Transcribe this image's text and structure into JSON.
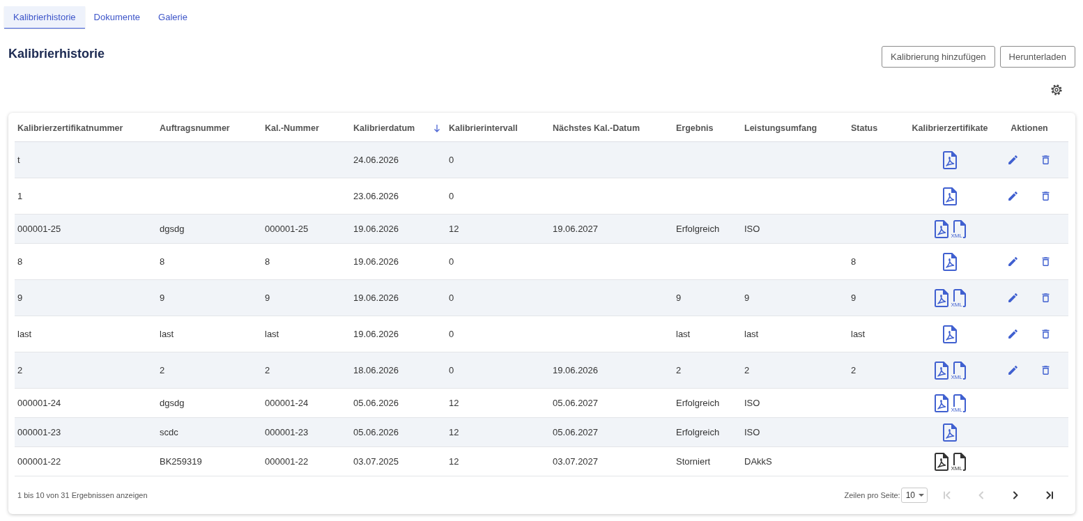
{
  "tabs": [
    {
      "label": "Kalibrierhistorie",
      "selected": true
    },
    {
      "label": "Dokumente",
      "selected": false
    },
    {
      "label": "Galerie",
      "selected": false
    }
  ],
  "page": {
    "title": "Kalibrierhistorie",
    "buttons": [
      "Kalibrierung hinzufügen",
      "Herunterladen"
    ]
  },
  "table": {
    "columns": [
      {
        "label": "Kalibrierzertifikatnummer",
        "sorted": false
      },
      {
        "label": "Auftragsnummer",
        "sorted": false
      },
      {
        "label": "Kal.-Nummer",
        "sorted": false
      },
      {
        "label": "Kalibrierdatum",
        "sorted": true
      },
      {
        "label": "Kalibrierintervall",
        "sorted": false
      },
      {
        "label": "Nächstes Kal.-Datum",
        "sorted": false
      },
      {
        "label": "Ergebnis",
        "sorted": false
      },
      {
        "label": "Leistungsumfang",
        "sorted": false
      },
      {
        "label": "Status",
        "sorted": false
      },
      {
        "label": "Kalibrierzertifikate",
        "sorted": false
      },
      {
        "label": "Aktionen",
        "sorted": false
      }
    ],
    "rows": [
      {
        "cells": [
          "t",
          null,
          null,
          "24.06.2026",
          "0",
          null,
          null,
          null,
          null
        ],
        "certificates": [
          {
            "kind": "pdf",
            "color": "#4060d0"
          }
        ],
        "actions": [
          {
            "kind": "edit"
          },
          {
            "kind": "delete"
          }
        ]
      },
      {
        "cells": [
          "1",
          null,
          null,
          "23.06.2026",
          "0",
          null,
          null,
          null,
          null
        ],
        "certificates": [
          {
            "kind": "pdf",
            "color": "#4060d0"
          }
        ],
        "actions": [
          {
            "kind": "edit"
          },
          {
            "kind": "delete"
          }
        ]
      },
      {
        "cells": [
          "000001-25",
          "dgsdg",
          "000001-25",
          "19.06.2026",
          "12",
          "19.06.2027",
          "Erfolgreich",
          "ISO",
          null
        ],
        "certificates": [
          {
            "kind": "pdf",
            "color": "#4060d0"
          },
          {
            "kind": "xml",
            "label": "XML",
            "color": "#4060d0"
          }
        ]
      },
      {
        "cells": [
          "8",
          "8",
          "8",
          "19.06.2026",
          "0",
          null,
          null,
          null,
          "8"
        ],
        "certificates": [
          {
            "kind": "pdf",
            "color": "#4060d0"
          }
        ],
        "actions": [
          {
            "kind": "edit"
          },
          {
            "kind": "delete"
          }
        ]
      },
      {
        "cells": [
          "9",
          "9",
          "9",
          "19.06.2026",
          "0",
          null,
          "9",
          "9",
          "9"
        ],
        "certificates": [
          {
            "kind": "pdf",
            "color": "#4060d0"
          },
          {
            "kind": "xml",
            "label": "XML",
            "color": "#4060d0"
          }
        ],
        "actions": [
          {
            "kind": "edit"
          },
          {
            "kind": "delete"
          }
        ]
      },
      {
        "cells": [
          "last",
          "last",
          "last",
          "19.06.2026",
          "0",
          null,
          "last",
          "last",
          "last"
        ],
        "certificates": [
          {
            "kind": "pdf",
            "color": "#4060d0"
          }
        ],
        "actions": [
          {
            "kind": "edit"
          },
          {
            "kind": "delete"
          }
        ]
      },
      {
        "cells": [
          "2",
          "2",
          "2",
          "18.06.2026",
          "0",
          "19.06.2026",
          "2",
          "2",
          "2"
        ],
        "certificates": [
          {
            "kind": "pdf",
            "color": "#4060d0"
          },
          {
            "kind": "xml",
            "label": "XML",
            "color": "#4060d0"
          }
        ],
        "actions": [
          {
            "kind": "edit"
          },
          {
            "kind": "delete"
          }
        ]
      },
      {
        "cells": [
          "000001-24",
          "dgsdg",
          "000001-24",
          "05.06.2026",
          "12",
          "05.06.2027",
          "Erfolgreich",
          "ISO",
          null
        ],
        "certificates": [
          {
            "kind": "pdf",
            "color": "#4060d0"
          },
          {
            "kind": "xml",
            "label": "XML",
            "color": "#4060d0"
          }
        ]
      },
      {
        "cells": [
          "000001-23",
          "scdc",
          "000001-23",
          "05.06.2026",
          "12",
          "05.06.2027",
          "Erfolgreich",
          "ISO",
          null
        ],
        "certificates": [
          {
            "kind": "pdf",
            "color": "#4060d0"
          }
        ]
      },
      {
        "cells": [
          "000001-22",
          "BK259319",
          "000001-22",
          "03.07.2025",
          "12",
          "03.07.2027",
          "Storniert",
          "DAkkS",
          null
        ],
        "certificates": [
          {
            "kind": "pdf",
            "color": "#333333"
          },
          {
            "kind": "xml",
            "label": "XML",
            "color": "#333333"
          }
        ]
      }
    ]
  },
  "pagination": {
    "summary": "1 bis 10 von 31 Ergebnissen anzeigen",
    "rows_per_page_label": "Zeilen pro Seite:",
    "rows_per_page": "10",
    "buttons": [
      {
        "kind": "first",
        "disabled": true
      },
      {
        "kind": "prev",
        "disabled": true
      },
      {
        "kind": "next",
        "disabled": false
      },
      {
        "kind": "last",
        "disabled": false
      }
    ]
  }
}
